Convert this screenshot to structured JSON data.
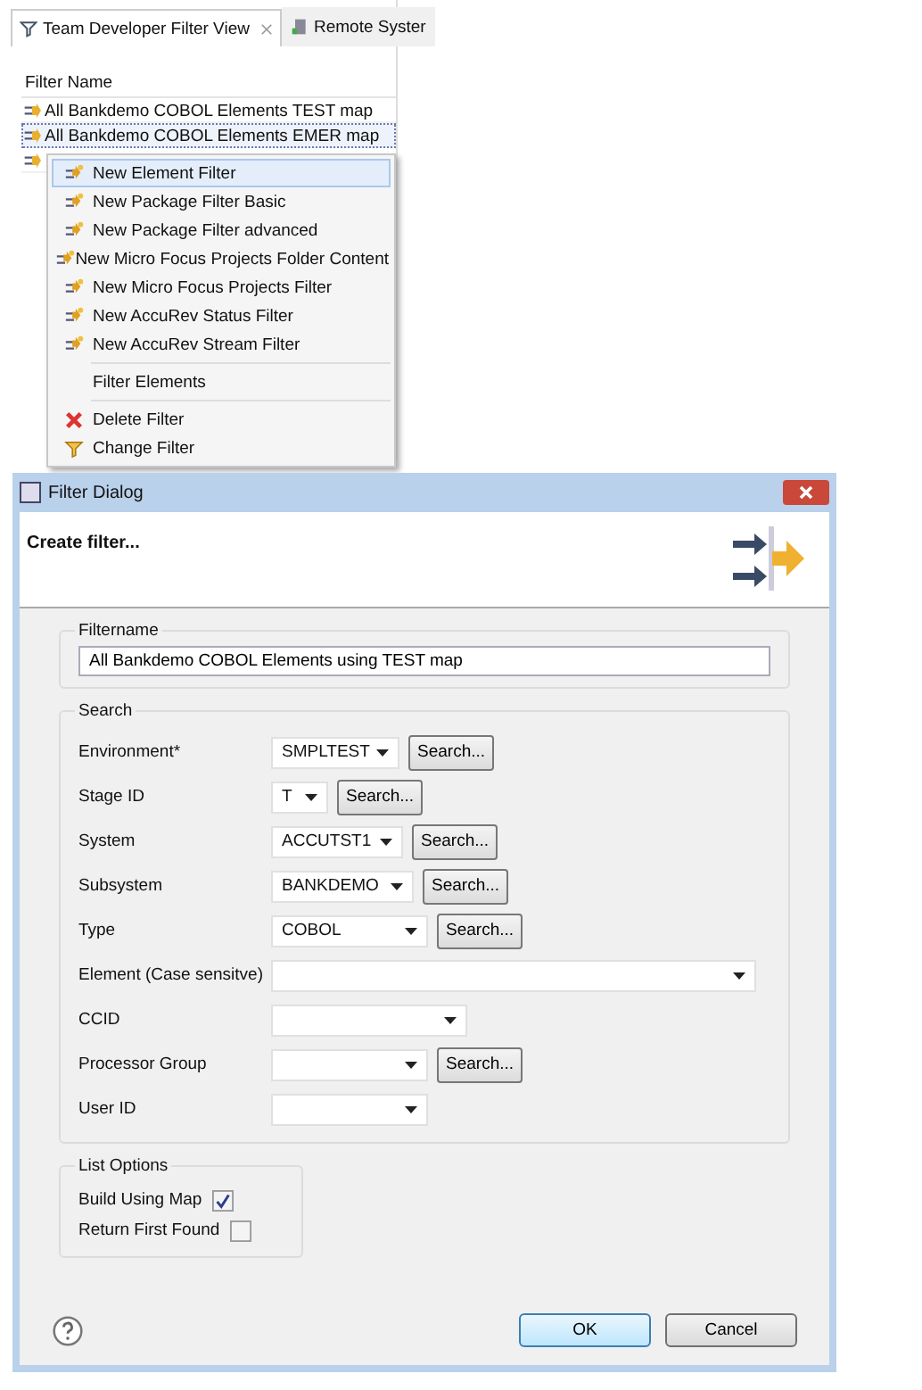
{
  "view_tabs": [
    {
      "label": "Team Developer Filter View",
      "selected": true,
      "closable": true
    },
    {
      "label": "Remote Syster",
      "selected": false,
      "closable": false
    }
  ],
  "filter_table": {
    "column": "Filter Name",
    "rows": [
      {
        "name": "All Bankdemo COBOL Elements TEST map",
        "selected": false
      },
      {
        "name": "All Bankdemo COBOL Elements EMER map",
        "selected": true
      },
      {
        "selected": false
      }
    ]
  },
  "context_menu": [
    {
      "kind": "new",
      "label": "New Element Filter",
      "selected": true
    },
    {
      "kind": "new",
      "label": "New Package Filter Basic",
      "selected": false
    },
    {
      "kind": "new",
      "label": "New Package Filter advanced",
      "selected": false
    },
    {
      "kind": "new",
      "label": "New Micro Focus Projects Folder Content",
      "selected": false
    },
    {
      "kind": "new",
      "label": "New Micro Focus Projects Filter",
      "selected": false
    },
    {
      "kind": "new",
      "label": "New AccuRev Status Filter",
      "selected": false
    },
    {
      "kind": "new",
      "label": "New AccuRev Stream Filter",
      "selected": false
    },
    {
      "kind": "separator"
    },
    {
      "kind": "plain",
      "label": "Filter Elements",
      "selected": false
    },
    {
      "kind": "separator"
    },
    {
      "kind": "delete",
      "label": "Delete Filter",
      "selected": false
    },
    {
      "kind": "change",
      "label": "Change Filter",
      "selected": false
    }
  ],
  "dialog": {
    "title": "Filter Dialog",
    "heading": "Create filter...",
    "filtername": {
      "label": "Filtername",
      "value": "All Bankdemo COBOL Elements using TEST map"
    },
    "search": {
      "label": "Search",
      "fields": [
        {
          "label": "Environment*",
          "value": "SMPLTEST",
          "search_button": "Search..."
        },
        {
          "label": "Stage ID",
          "value": "T",
          "search_button": "Search..."
        },
        {
          "label": "System",
          "value": "ACCUTST1",
          "search_button": "Search..."
        },
        {
          "label": "Subsystem",
          "value": "BANKDEMO",
          "search_button": "Search..."
        },
        {
          "label": "Type",
          "value": "COBOL",
          "search_button": "Search..."
        },
        {
          "label": "Element (Case sensitve)"
        },
        {
          "label": "CCID"
        },
        {
          "label": "Processor Group",
          "search_button": "Search..."
        },
        {
          "label": "User ID"
        }
      ]
    },
    "list_options": {
      "label": "List Options",
      "items": [
        {
          "label": "Build Using Map",
          "checked": true
        },
        {
          "label": "Return First Found",
          "checked": false
        }
      ]
    },
    "buttons": [
      {
        "label": "OK",
        "default": true
      },
      {
        "label": "Cancel",
        "default": false
      }
    ]
  }
}
